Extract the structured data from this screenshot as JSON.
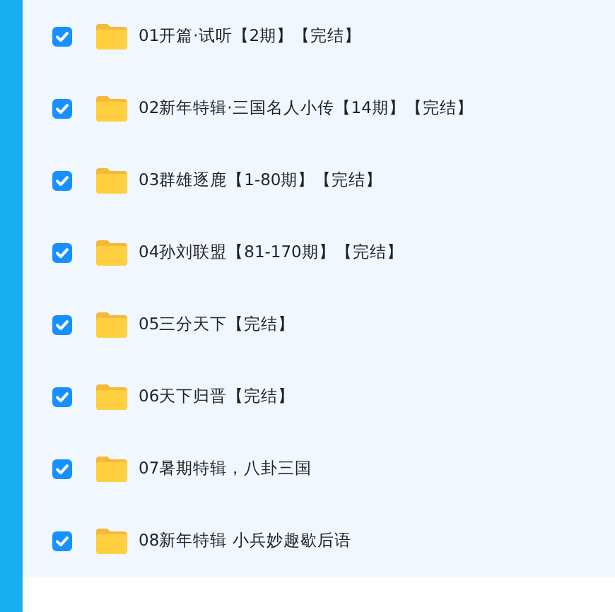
{
  "folders": [
    {
      "name": "01开篇·试听【2期】【完结】",
      "checked": true
    },
    {
      "name": "02新年特辑·三国名人小传【14期】【完结】",
      "checked": true
    },
    {
      "name": "03群雄逐鹿【1-80期】【完结】",
      "checked": true
    },
    {
      "name": "04孙刘联盟【81-170期】【完结】",
      "checked": true
    },
    {
      "name": "05三分天下【完结】",
      "checked": true
    },
    {
      "name": "06天下归晋【完结】",
      "checked": true
    },
    {
      "name": "07暑期特辑，八卦三国",
      "checked": true
    },
    {
      "name": "08新年特辑 小兵妙趣歇后语",
      "checked": true
    }
  ]
}
